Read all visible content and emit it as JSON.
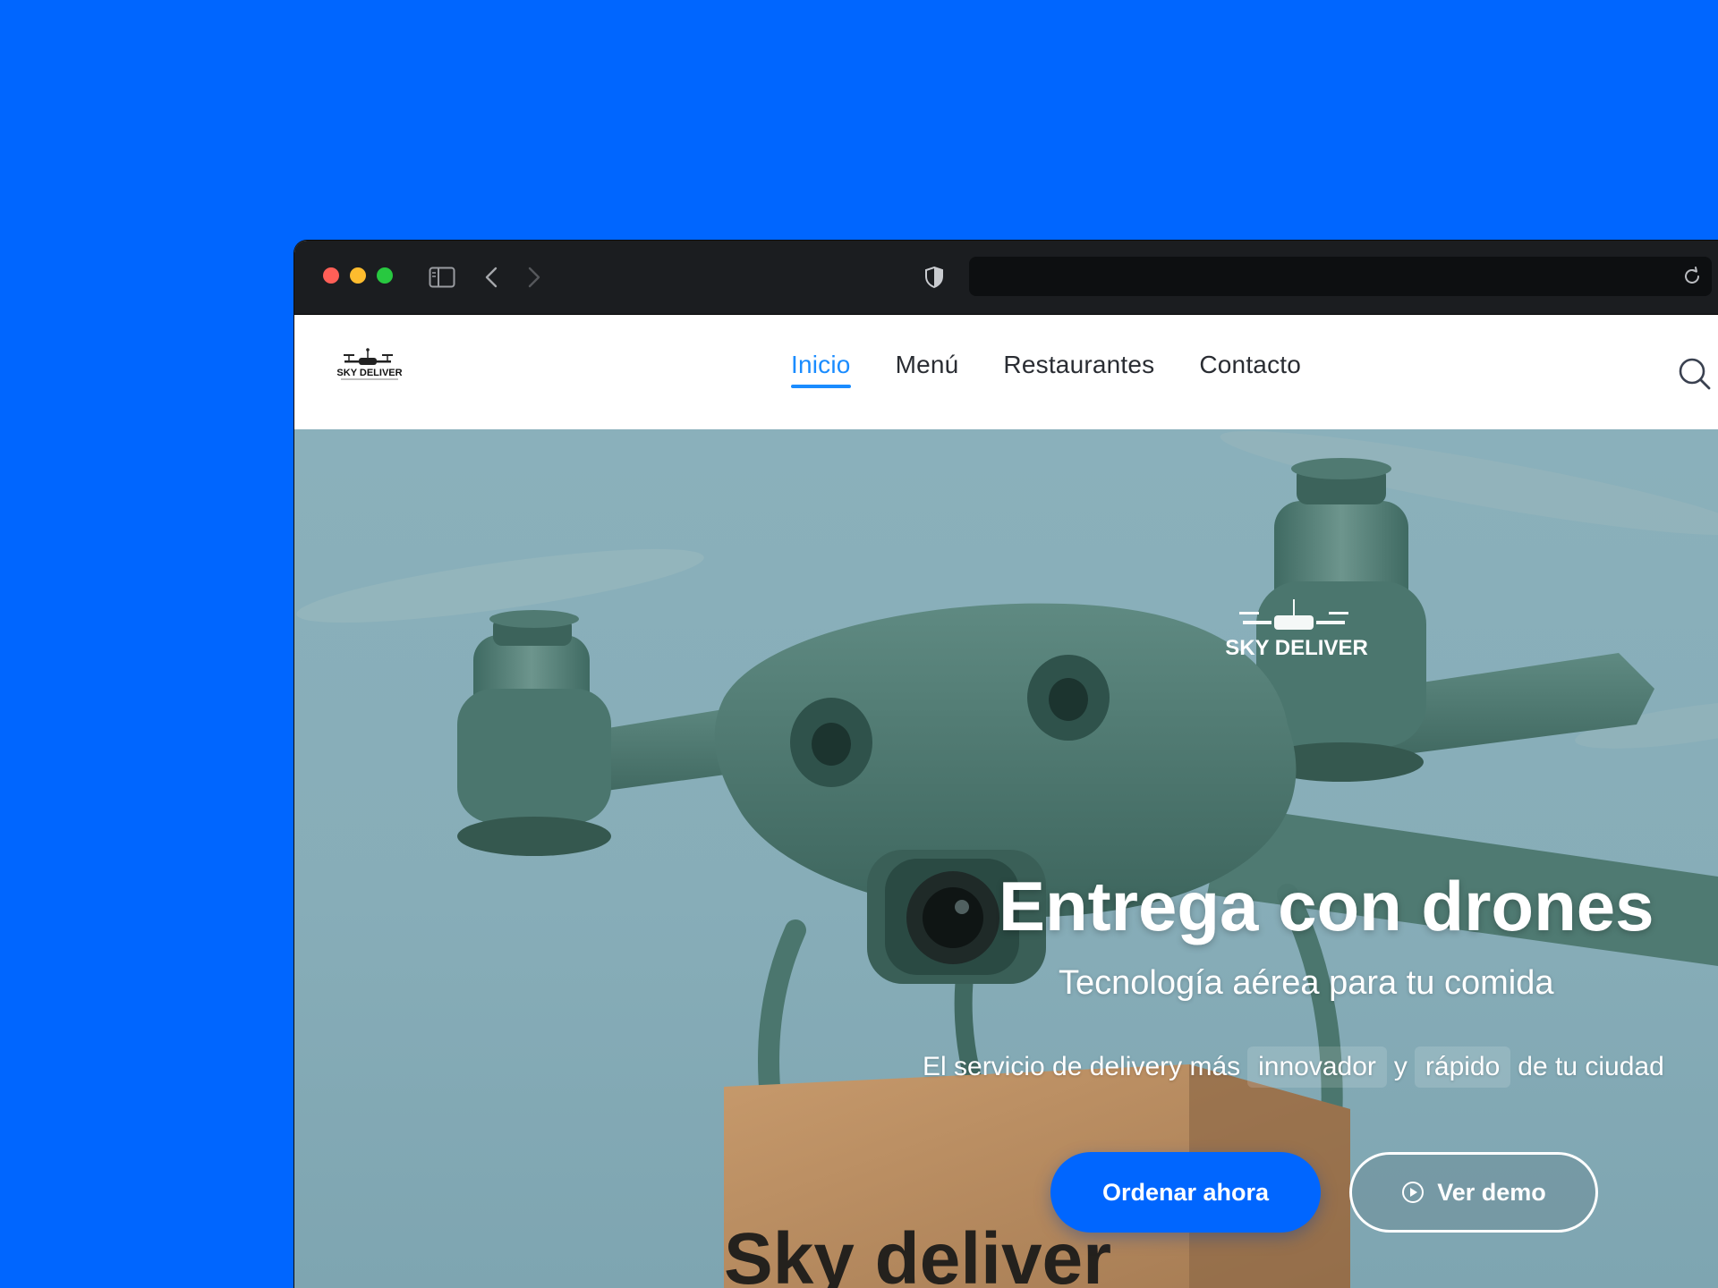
{
  "site": {
    "logo_text": "SKY DELIVER",
    "nav": [
      {
        "label": "Inicio"
      },
      {
        "label": "Menú"
      },
      {
        "label": "Restaurantes"
      },
      {
        "label": "Contacto"
      }
    ]
  },
  "hero": {
    "drone_brand": "SKY DELIVER",
    "box_text": "Sky deliver",
    "title": "Entrega con drones",
    "subtitle": "Tecnología aérea para tu comida",
    "tagline": {
      "prefix": "El servicio de delivery más",
      "word1": "innovador",
      "joiner": "y",
      "word2": "rápido",
      "suffix": "de tu ciudad"
    },
    "primary_button": "Ordenar ahora",
    "secondary_button": "Ver demo"
  },
  "icons": {
    "sidebar": "sidebar-icon",
    "back": "chevron-left-icon",
    "forward": "chevron-right-icon",
    "privacy": "shield-icon",
    "reload": "reload-icon",
    "search": "search-icon",
    "play": "play-icon"
  },
  "colors": {
    "background": "#0066ff",
    "accent": "#1a8cff",
    "primary_button": "#0066ff"
  }
}
